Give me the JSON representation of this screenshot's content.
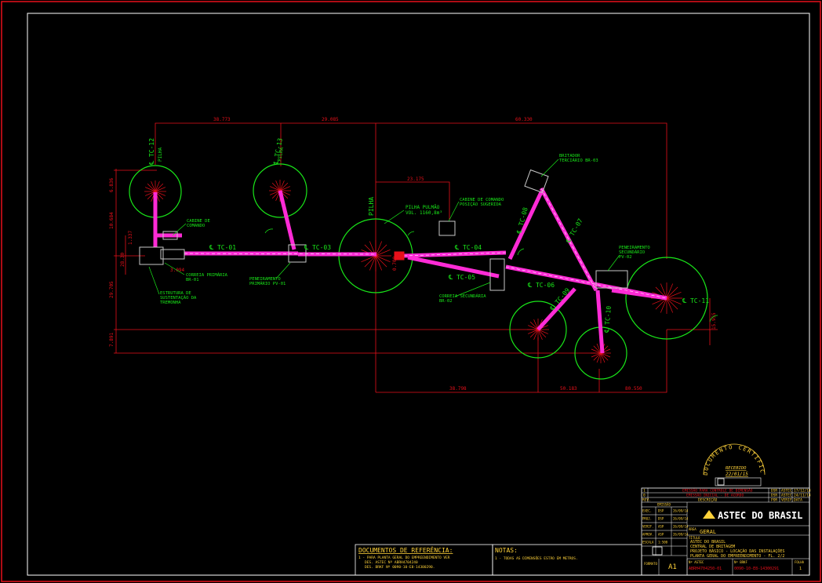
{
  "colors": {
    "background": "#000000",
    "frame": "#e8101a",
    "inner_frame": "#ffffff",
    "dimension": "#e8101a",
    "conveyor": "#ff2bd6",
    "stockpile": "#19e619",
    "label": "#19e619",
    "equipment": "#c8c8c8",
    "title_text": "#ffd23a"
  },
  "dimensions": {
    "top_1": "38.773",
    "top_2": "29.085",
    "top_3": "60.330",
    "bottom_1": "38.798",
    "bottom_2": "50.183",
    "bottom_3": "80.550",
    "tc04_span": "23.175",
    "left_1": "6.836",
    "left_2": "10.684",
    "left_3": "1.337",
    "left_4": "29.705",
    "left_5": "7.891",
    "left_6": "28.30",
    "left_7": "3.094",
    "right_1": "15.955"
  },
  "conveyors": {
    "tc01": "℄ TC-01",
    "tc03": "℄ TC-03",
    "tc04": "℄ TC-04",
    "tc05": "℄ TC-05",
    "tc06": "℄ TC-06",
    "tc07": "℄ TC-07",
    "tc08": "℄ TC-08",
    "tc09": "℄ TC-09",
    "tc10": "℄ TC-10",
    "tc11": "℄ TC-11",
    "tc12": "℄ TC-12",
    "tc13": "℄ TC-13"
  },
  "stockpiles": {
    "pilha_left": "PILHA",
    "pilha_second": "PILHA",
    "pilha_center": "PILHA",
    "pulmao": "PILHA PULMÃO",
    "pulmao_vol": "VOL. 1160,8m³"
  },
  "equipment_labels": {
    "cabine_1": "CABINE DE",
    "cabine_2": "COMANDO",
    "cabine_pos_1": "CABINE DE COMANDO",
    "cabine_pos_2": "POSIÇÃO SUGERIDA",
    "britador_1": "BRITADOR",
    "britador_2": "TERCIÁRIO BR-03",
    "peneira_sec_1": "PENEIRAMENTO",
    "peneira_sec_2": "SECUNDÁRIO",
    "peneira_sec_3": "PV-02",
    "peneira_pri_1": "PENEIRAMENTO",
    "peneira_pri_2": "PRIMÁRIO PV-01",
    "corr_pri_1": "CORREIA PRIMÁRIA",
    "corr_pri_2": "BR-01",
    "estrutura_1": "ESTRUTURA DE",
    "estrutura_2": "SUSTENTAÇÃO DA",
    "estrutura_3": "TREMONHA",
    "corr_sec_1": "CORREIA SECUNDÁRIA",
    "corr_sec_2": "BR-02"
  },
  "references": {
    "title": "DOCUMENTOS DE REFERÊNCIA:",
    "line_1": "1 - PARA PLANTA GERAL DO EMPREENDIMENTO VER",
    "line_2": "DES. ASTEC Nº ABRH4704240",
    "line_3": "DES. BRKF Nº 0090-10-E8-14300290."
  },
  "notes": {
    "title": "NOTAS:",
    "line_1": "1 - TODAS AS DIMENSÕES ESTÃO EM METROS."
  },
  "stamp": {
    "arc_text": "DOCUMENTO CERTIFICADO",
    "status": "RECEBIDO",
    "date": "22/01/15"
  },
  "title_block": {
    "rev_rows": [
      {
        "rev": "1",
        "desc": "EMISSÃO PARA CONTROLE DE DIMENSÃO",
        "by": "DSR",
        "chk": "ASTEC",
        "date": "17/12/14"
      },
      {
        "rev": "0",
        "desc": "EMISSÃO INICIAL - DE ACORDO",
        "by": "DSR",
        "chk": "ASTEC",
        "date": "24/11/14"
      },
      {
        "rev": "REV.",
        "desc": "DESCRIÇÃO",
        "by": "POR",
        "chk": "VERIF.",
        "date": "DATA"
      }
    ],
    "sign_header": "EMISSÃO",
    "sign_rows": [
      {
        "role": "EXEC.",
        "name": "DSP",
        "date": "26/09/14"
      },
      {
        "role": "PROJ.",
        "name": "DSP",
        "date": "26/09/14"
      },
      {
        "role": "VERIF.",
        "name": "ASP",
        "date": "26/09/14"
      },
      {
        "role": "APROV.",
        "name": "ASP",
        "date": "26/09/14"
      },
      {
        "role": "ESCALA",
        "name": "1:500",
        "date": ""
      }
    ],
    "brand": "ASTEC DO BRASIL",
    "area_label": "ÁREA",
    "area": "GERAL",
    "desc_label": "TÍTULO",
    "desc_1": "ASTEC DO BRASIL",
    "desc_2": "CENTRAL DE BRITAGEM",
    "desc_3": "PROJETO BÁSICO - LOCAÇÃO DAS INSTALAÇÕES",
    "desc_4": "PLANTA GERAL DO EMPREENDIMENTO - FL. 2/2",
    "format_label": "FORMATO",
    "format": "A1",
    "num_label": "Nº ASTEC",
    "num_value": "ABRH4704250-01",
    "client_num_label": "Nº BRKF",
    "client_num_value": "0090-10-E8-14300291",
    "sheet_label": "FOLHA",
    "sheet_value": "1"
  }
}
